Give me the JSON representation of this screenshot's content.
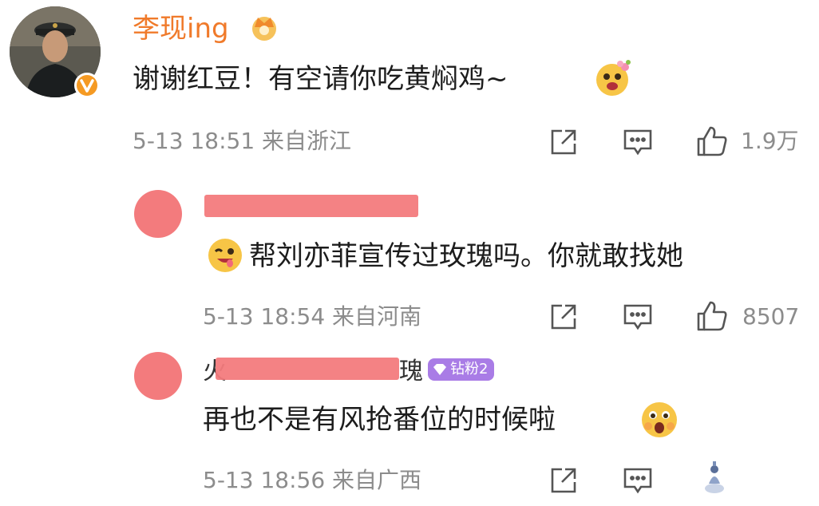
{
  "comments": [
    {
      "user": "李现ing",
      "text": "谢谢红豆！有空请你吃黄焖鸡~",
      "meta": "5-13 18:51 来自浙江",
      "likes": "1.9万"
    },
    {
      "text": "帮刘亦菲宣传过玫瑰吗。你就敢找她",
      "meta": "5-13 18:54 来自河南",
      "likes": "8507"
    },
    {
      "name_prefix": "火",
      "name_suffix": "瑰",
      "badge": "钻粉2",
      "text": "再也不是有风抢番位的时候啦",
      "meta": "5-13 18:56 来自广西"
    }
  ],
  "icons": [
    "crown-icon",
    "verified-icon",
    "share-icon",
    "comment-icon",
    "like-icon",
    "emoji-icon",
    "diamond-icon"
  ],
  "colors": {
    "username": "#f07a2a",
    "meta": "#8c8c8c",
    "redaction": "#f37b7d",
    "badge": "#a97ce6",
    "verified": "#f59a23"
  }
}
